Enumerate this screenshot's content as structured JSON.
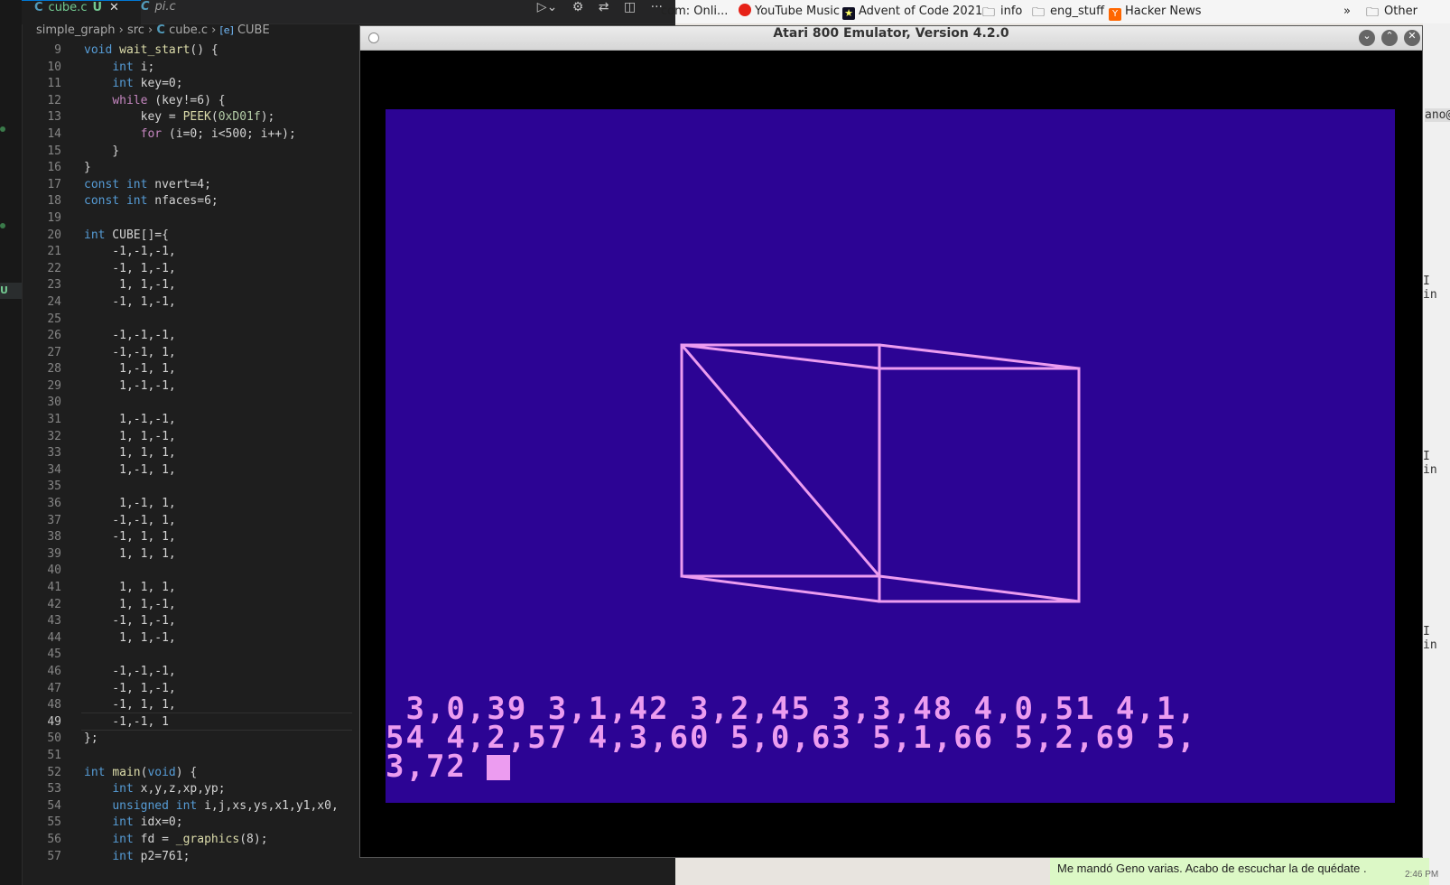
{
  "editor": {
    "tabs": [
      {
        "label": "cube.c",
        "status": "U"
      },
      {
        "label": "pi.c"
      }
    ],
    "breadcrumb": [
      "simple_graph",
      "src",
      "cube.c",
      "CUBE"
    ],
    "activity_badge": "U",
    "lines": [
      {
        "n": "9",
        "code": "void wait_start() {"
      },
      {
        "n": "10",
        "code": "    int i;"
      },
      {
        "n": "11",
        "code": "    int key=0;"
      },
      {
        "n": "12",
        "code": "    while (key!=6) {"
      },
      {
        "n": "13",
        "code": "        key = PEEK(0xD01f);"
      },
      {
        "n": "14",
        "code": "        for (i=0; i<500; i++);"
      },
      {
        "n": "15",
        "code": "    }"
      },
      {
        "n": "16",
        "code": "}"
      },
      {
        "n": "17",
        "code": "const int nvert=4;"
      },
      {
        "n": "18",
        "code": "const int nfaces=6;"
      },
      {
        "n": "19",
        "code": ""
      },
      {
        "n": "20",
        "code": "int CUBE[]={"
      },
      {
        "n": "21",
        "code": "    -1,-1,-1,"
      },
      {
        "n": "22",
        "code": "    -1, 1,-1,"
      },
      {
        "n": "23",
        "code": "     1, 1,-1,"
      },
      {
        "n": "24",
        "code": "    -1, 1,-1,"
      },
      {
        "n": "25",
        "code": ""
      },
      {
        "n": "26",
        "code": "    -1,-1,-1,"
      },
      {
        "n": "27",
        "code": "    -1,-1, 1,"
      },
      {
        "n": "28",
        "code": "     1,-1, 1,"
      },
      {
        "n": "29",
        "code": "     1,-1,-1,"
      },
      {
        "n": "30",
        "code": ""
      },
      {
        "n": "31",
        "code": "     1,-1,-1,"
      },
      {
        "n": "32",
        "code": "     1, 1,-1,"
      },
      {
        "n": "33",
        "code": "     1, 1, 1,"
      },
      {
        "n": "34",
        "code": "     1,-1, 1,"
      },
      {
        "n": "35",
        "code": ""
      },
      {
        "n": "36",
        "code": "     1,-1, 1,"
      },
      {
        "n": "37",
        "code": "    -1,-1, 1,"
      },
      {
        "n": "38",
        "code": "    -1, 1, 1,"
      },
      {
        "n": "39",
        "code": "     1, 1, 1,"
      },
      {
        "n": "40",
        "code": ""
      },
      {
        "n": "41",
        "code": "     1, 1, 1,"
      },
      {
        "n": "42",
        "code": "     1, 1,-1,"
      },
      {
        "n": "43",
        "code": "    -1, 1,-1,"
      },
      {
        "n": "44",
        "code": "     1, 1,-1,"
      },
      {
        "n": "45",
        "code": ""
      },
      {
        "n": "46",
        "code": "    -1,-1,-1,"
      },
      {
        "n": "47",
        "code": "    -1, 1,-1,"
      },
      {
        "n": "48",
        "code": "    -1, 1, 1,"
      },
      {
        "n": "49",
        "code": "    -1,-1, 1"
      },
      {
        "n": "50",
        "code": "};"
      },
      {
        "n": "51",
        "code": ""
      },
      {
        "n": "52",
        "code": "int main(void) {"
      },
      {
        "n": "53",
        "code": "    int x,y,z,xp,yp;"
      },
      {
        "n": "54",
        "code": "    unsigned int i,j,xs,ys,x1,y1,x0,"
      },
      {
        "n": "55",
        "code": "    int idx=0;"
      },
      {
        "n": "56",
        "code": "    int fd = _graphics(8);"
      },
      {
        "n": "57",
        "code": "    int p2=761;"
      }
    ],
    "current_line": "49"
  },
  "bookmarks": [
    {
      "label": "com: Onli...",
      "icon": "page-icon"
    },
    {
      "label": "YouTube Music",
      "icon": "youtube-music-icon",
      "color": "#e62117"
    },
    {
      "label": "Advent of Code 2021",
      "icon": "star-icon",
      "color": "#ffff66"
    },
    {
      "label": "info",
      "icon": "folder-icon"
    },
    {
      "label": "eng_stuff",
      "icon": "folder-icon"
    },
    {
      "label": "Hacker News",
      "icon": "hn-icon",
      "color": "#ff6600"
    },
    {
      "label": "Other",
      "icon": "folder-icon"
    }
  ],
  "right_strip": {
    "top": "ano@",
    "rows": [
      "I in",
      "I in",
      "I in"
    ]
  },
  "chat": {
    "message": "Me mandó Geno varias. Acabo de escuchar la de  quédate .",
    "time": "2:46 PM"
  },
  "emulator": {
    "title": "Atari 800 Emulator, Version 4.2.0",
    "output_lines": [
      " 3,0,39 3,1,42 3,2,45 3,3,48 4,0,51 4,1,",
      "54 4,2,57 4,3,60 5,0,63 5,1,66 5,2,69 5,",
      "3,72"
    ],
    "colors": {
      "background": "#2c0494",
      "foreground": "#ec9cf0"
    }
  }
}
